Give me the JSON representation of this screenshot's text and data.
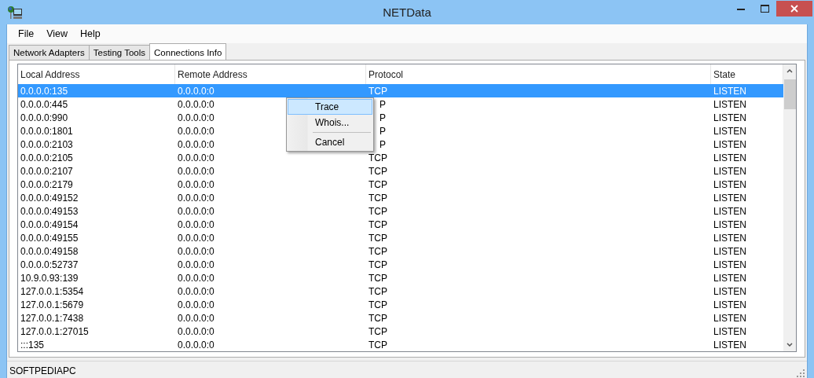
{
  "window": {
    "title": "NETData"
  },
  "menu_bar": [
    "File",
    "View",
    "Help"
  ],
  "tabs": [
    {
      "label": "Network Adapters",
      "selected": false
    },
    {
      "label": "Testing Tools",
      "selected": false
    },
    {
      "label": "Connections Info",
      "selected": true
    }
  ],
  "table": {
    "columns": [
      "Local Address",
      "Remote Address",
      "Protocol",
      "State"
    ],
    "rows": [
      {
        "cells": [
          "0.0.0.0:135",
          "0.0.0.0:0",
          "TCP",
          "LISTEN"
        ],
        "selected": true
      },
      {
        "cells": [
          "0.0.0.0:445",
          "0.0.0.0:0",
          "P",
          "LISTEN"
        ],
        "selected": false
      },
      {
        "cells": [
          "0.0.0.0:990",
          "0.0.0.0:0",
          "P",
          "LISTEN"
        ],
        "selected": false
      },
      {
        "cells": [
          "0.0.0.0:1801",
          "0.0.0.0:0",
          "P",
          "LISTEN"
        ],
        "selected": false
      },
      {
        "cells": [
          "0.0.0.0:2103",
          "0.0.0.0:0",
          "P",
          "LISTEN"
        ],
        "selected": false
      },
      {
        "cells": [
          "0.0.0.0:2105",
          "0.0.0.0:0",
          "TCP",
          "LISTEN"
        ],
        "selected": false
      },
      {
        "cells": [
          "0.0.0.0:2107",
          "0.0.0.0:0",
          "TCP",
          "LISTEN"
        ],
        "selected": false
      },
      {
        "cells": [
          "0.0.0.0:2179",
          "0.0.0.0:0",
          "TCP",
          "LISTEN"
        ],
        "selected": false
      },
      {
        "cells": [
          "0.0.0.0:49152",
          "0.0.0.0:0",
          "TCP",
          "LISTEN"
        ],
        "selected": false
      },
      {
        "cells": [
          "0.0.0.0:49153",
          "0.0.0.0:0",
          "TCP",
          "LISTEN"
        ],
        "selected": false
      },
      {
        "cells": [
          "0.0.0.0:49154",
          "0.0.0.0:0",
          "TCP",
          "LISTEN"
        ],
        "selected": false
      },
      {
        "cells": [
          "0.0.0.0:49155",
          "0.0.0.0:0",
          "TCP",
          "LISTEN"
        ],
        "selected": false
      },
      {
        "cells": [
          "0.0.0.0:49158",
          "0.0.0.0:0",
          "TCP",
          "LISTEN"
        ],
        "selected": false
      },
      {
        "cells": [
          "0.0.0.0:52737",
          "0.0.0.0:0",
          "TCP",
          "LISTEN"
        ],
        "selected": false
      },
      {
        "cells": [
          "10.9.0.93:139",
          "0.0.0.0:0",
          "TCP",
          "LISTEN"
        ],
        "selected": false
      },
      {
        "cells": [
          "127.0.0.1:5354",
          "0.0.0.0:0",
          "TCP",
          "LISTEN"
        ],
        "selected": false
      },
      {
        "cells": [
          "127.0.0.1:5679",
          "0.0.0.0:0",
          "TCP",
          "LISTEN"
        ],
        "selected": false
      },
      {
        "cells": [
          "127.0.0.1:7438",
          "0.0.0.0:0",
          "TCP",
          "LISTEN"
        ],
        "selected": false
      },
      {
        "cells": [
          "127.0.0.1:27015",
          "0.0.0.0:0",
          "TCP",
          "LISTEN"
        ],
        "selected": false
      },
      {
        "cells": [
          ":::135",
          "0.0.0.0:0",
          "TCP",
          "LISTEN"
        ],
        "selected": false
      }
    ]
  },
  "context_menu": {
    "items": [
      {
        "kind": "item",
        "label": "Trace",
        "selected": true
      },
      {
        "kind": "item",
        "label": "Whois...",
        "selected": false
      },
      {
        "kind": "separator"
      },
      {
        "kind": "item",
        "label": "Cancel",
        "selected": false
      }
    ]
  },
  "status_bar": "SOFTPEDIAPC"
}
